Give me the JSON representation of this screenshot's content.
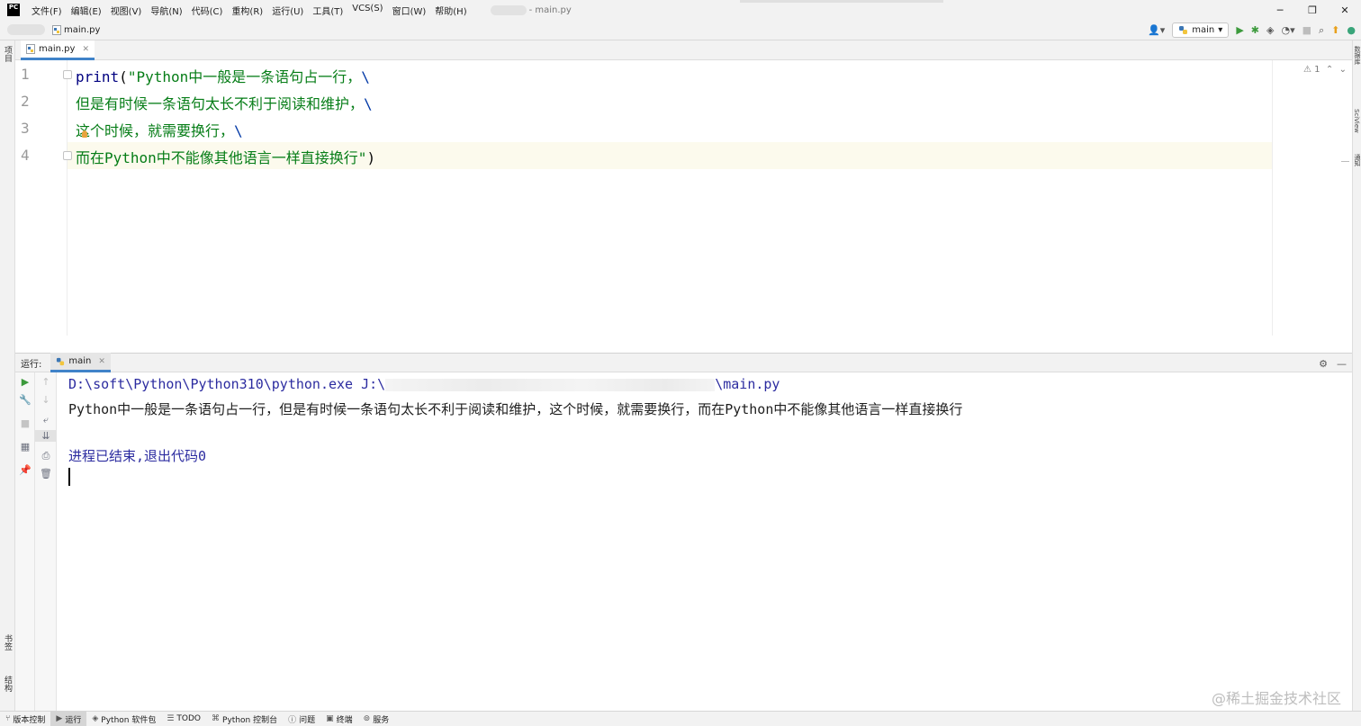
{
  "app": {
    "logo_text": "PC",
    "window_title": "- main.py",
    "menu": [
      "文件(F)",
      "编辑(E)",
      "视图(V)",
      "导航(N)",
      "代码(C)",
      "重构(R)",
      "运行(U)",
      "工具(T)",
      "VCS(S)",
      "窗口(W)",
      "帮助(H)"
    ]
  },
  "window_controls": {
    "minimize": "─",
    "restore": "❐",
    "close": "✕"
  },
  "navbar": {
    "file_crumb": "main.py",
    "run_config": "main",
    "icons": [
      "user-icon",
      "run-icon",
      "debug-icon",
      "coverage-icon",
      "profile-icon",
      "stop-icon",
      "search-icon",
      "update-icon",
      "plugin-icon"
    ]
  },
  "left_strip": {
    "project": "项目",
    "bookmarks": "书签",
    "structure": "结构"
  },
  "right_strip": {
    "database": "数据库",
    "sciview": "SciView",
    "notifications": "通知"
  },
  "editor": {
    "tab_label": "main.py",
    "line_numbers": [
      "1",
      "2",
      "3",
      "4"
    ],
    "inspection_count": "1",
    "lines": [
      {
        "kw": "print",
        "open": "(",
        "str": "\"Python中一般是一条语句占一行，",
        "esc": "\\",
        "close": ""
      },
      {
        "kw": "",
        "open": "",
        "str": "但是有时候一条语句太长不利于阅读和维护，",
        "esc": "\\",
        "close": ""
      },
      {
        "kw": "",
        "open": "",
        "str": "这个时候，就需要换行，",
        "esc": "\\",
        "close": ""
      },
      {
        "kw": "",
        "open": "",
        "str": "而在Python中不能像其他语言一样直接换行\"",
        "esc": "",
        "close": ")"
      }
    ]
  },
  "run_panel": {
    "title": "运行:",
    "tab_label": "main",
    "console": {
      "command_prefix": "D:\\soft\\Python\\Python310\\python.exe J:\\",
      "command_suffix": "\\main.py",
      "output": "Python中一般是一条语句占一行，但是有时候一条语句太长不利于阅读和维护，这个时候，就需要换行，而在Python中不能像其他语言一样直接换行",
      "exit_message": "进程已结束,退出代码0"
    }
  },
  "statusbar": {
    "items": [
      {
        "label": "版本控制",
        "icon": "vcs-icon",
        "active": false
      },
      {
        "label": "运行",
        "icon": "run-icon",
        "active": true
      },
      {
        "label": "Python 软件包",
        "icon": "packages-icon",
        "active": false
      },
      {
        "label": "TODO",
        "icon": "todo-icon",
        "active": false
      },
      {
        "label": "Python 控制台",
        "icon": "python-console-icon",
        "active": false
      },
      {
        "label": "问题",
        "icon": "problems-icon",
        "active": false
      },
      {
        "label": "终端",
        "icon": "terminal-icon",
        "active": false
      },
      {
        "label": "服务",
        "icon": "services-icon",
        "active": false
      }
    ]
  },
  "watermark": "@稀土掘金技术社区",
  "colors": {
    "keyword": "#000080",
    "string": "#067d17",
    "escape": "#0037a6",
    "console_command": "#2c2ca0",
    "tab_underline": "#4083c9",
    "caret_line": "#fcfaed"
  }
}
